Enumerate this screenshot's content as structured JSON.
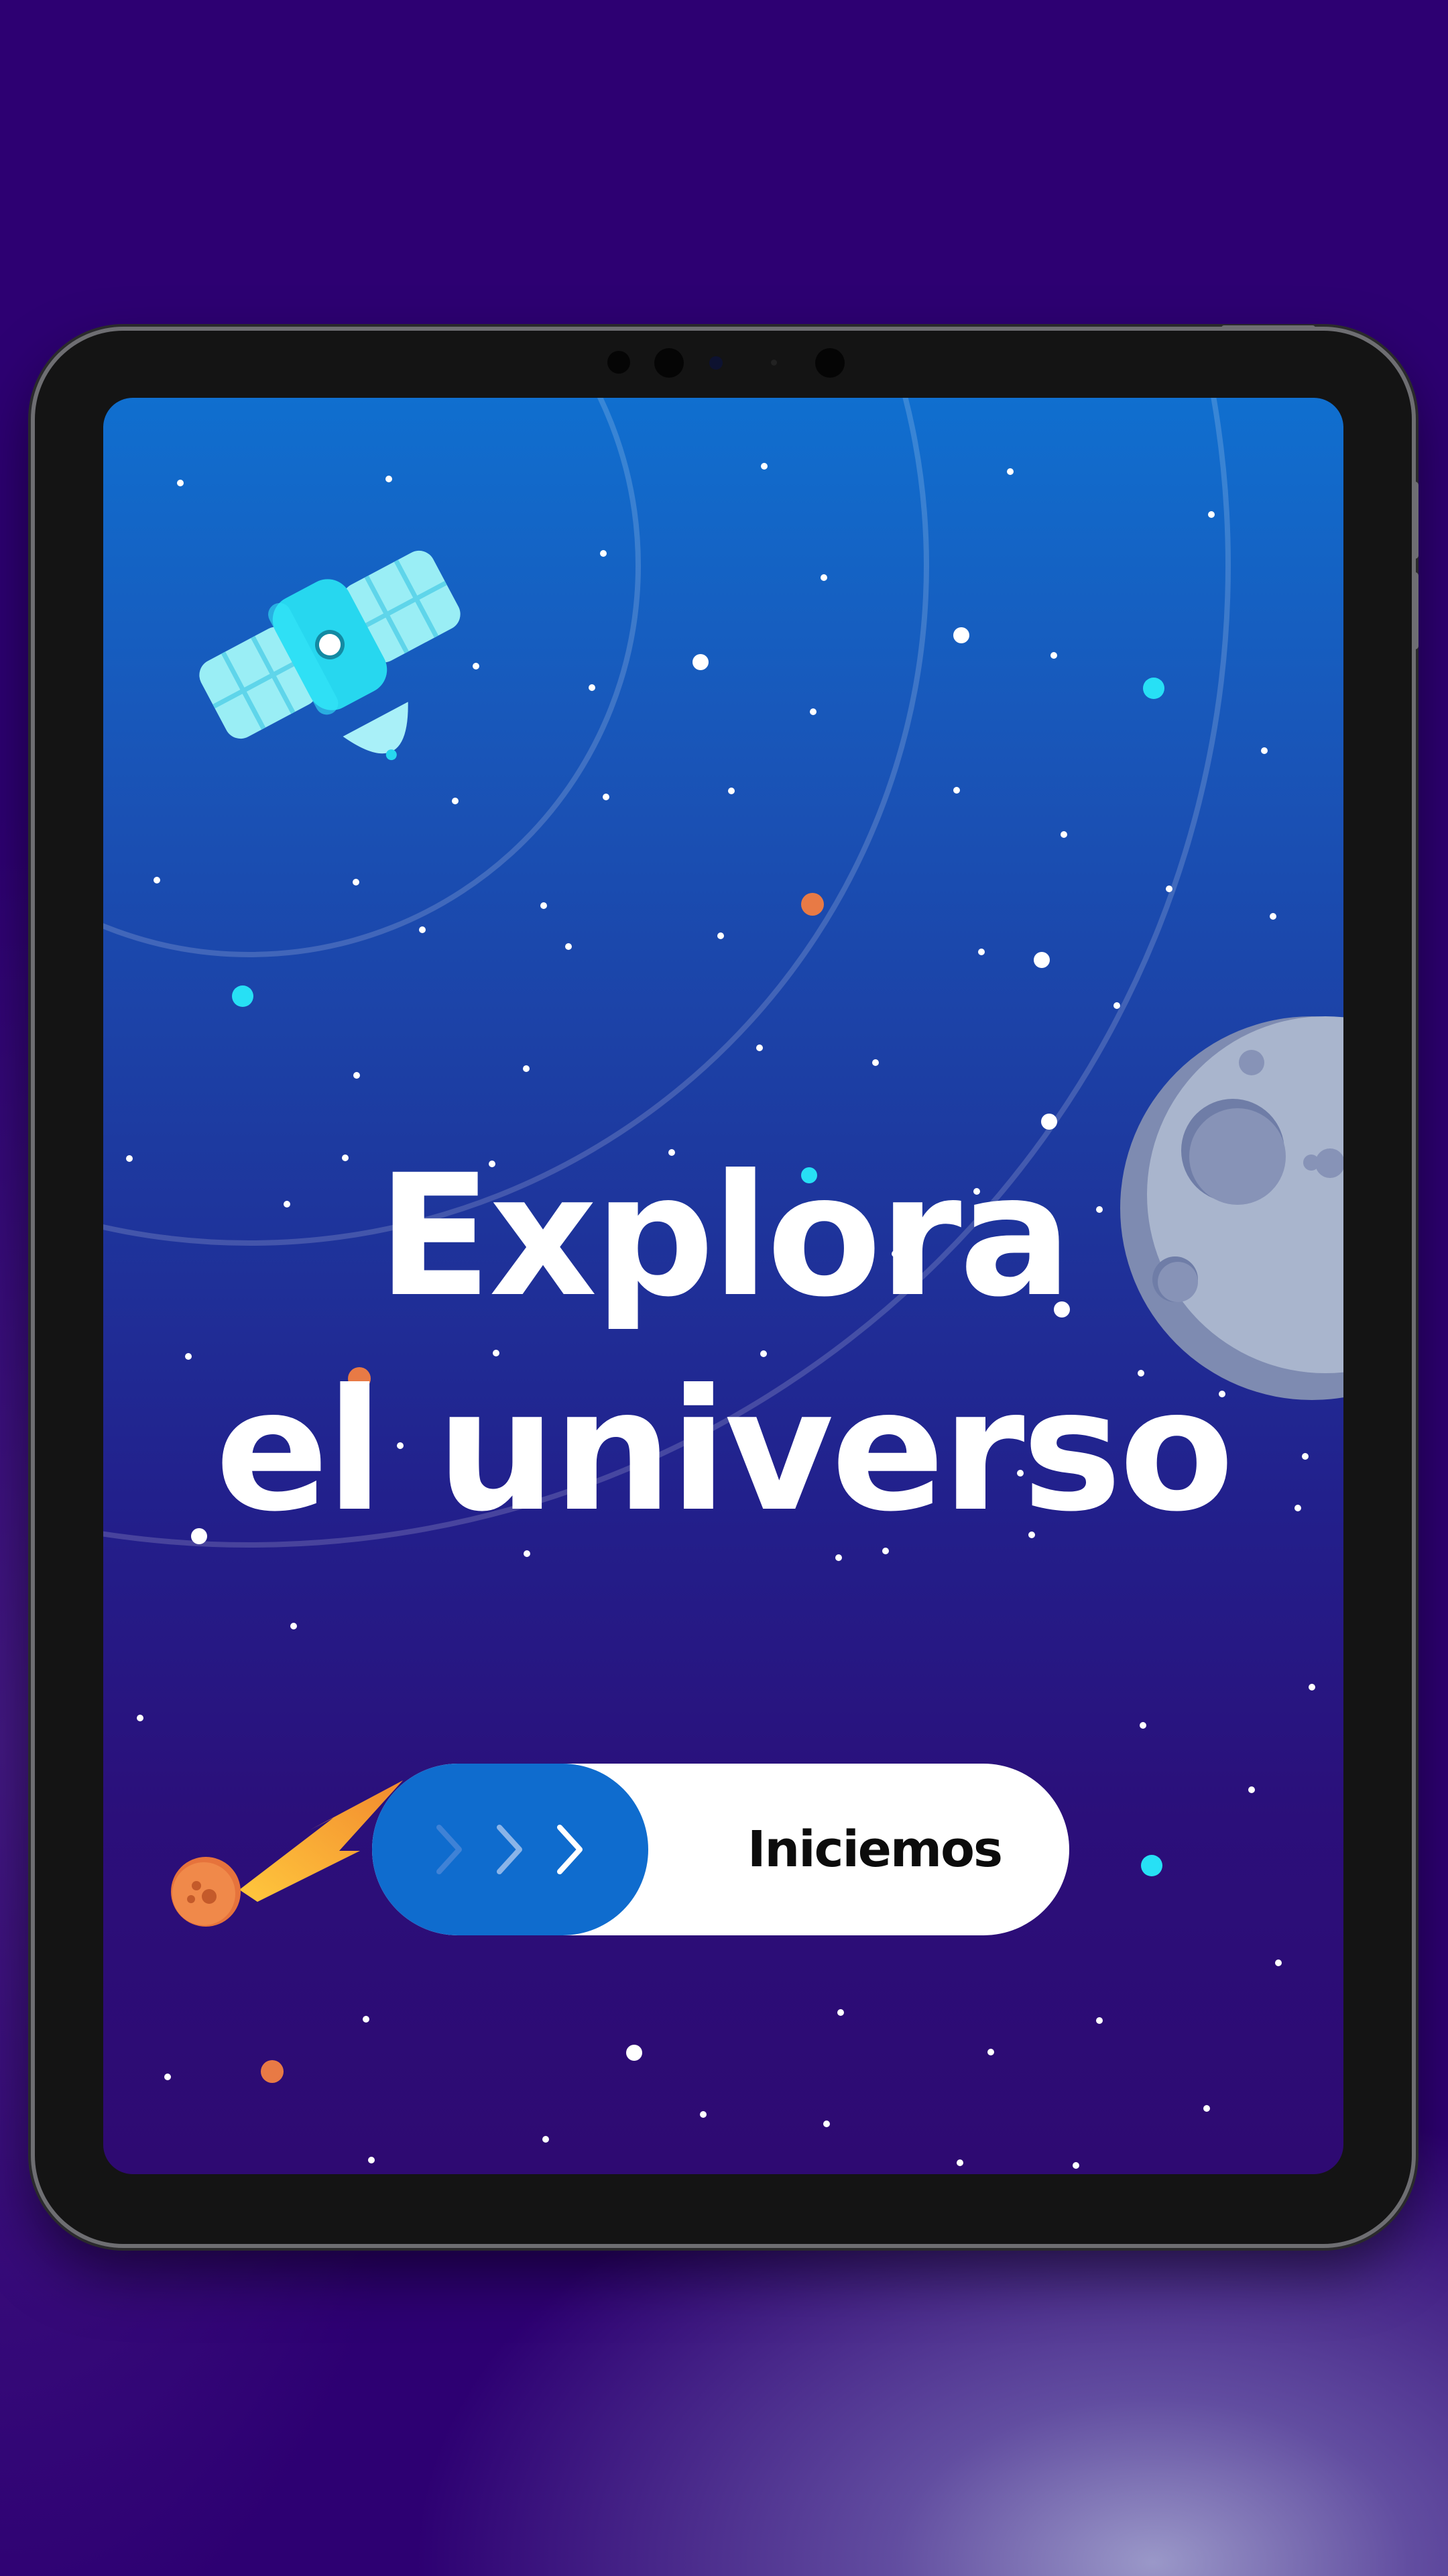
{
  "screen": {
    "headline_line1": "Explora",
    "headline_line2": "el universo",
    "start_slider": {
      "label": "Iniciemos",
      "chevrons": [
        "chevron-right-icon",
        "chevron-right-icon",
        "chevron-right-icon"
      ]
    },
    "illustrations": [
      "satellite-icon",
      "moon-icon",
      "comet-icon",
      "orbit-rings",
      "stars"
    ]
  },
  "colors": {
    "sky_top": "#106fcf",
    "sky_bottom": "#2e0a72",
    "backdrop": "#2d0072",
    "slider_knob": "#0f6cce",
    "slider_track": "#ffffff",
    "star_cyan": "#27e0f5",
    "star_orange": "#e87a45"
  }
}
